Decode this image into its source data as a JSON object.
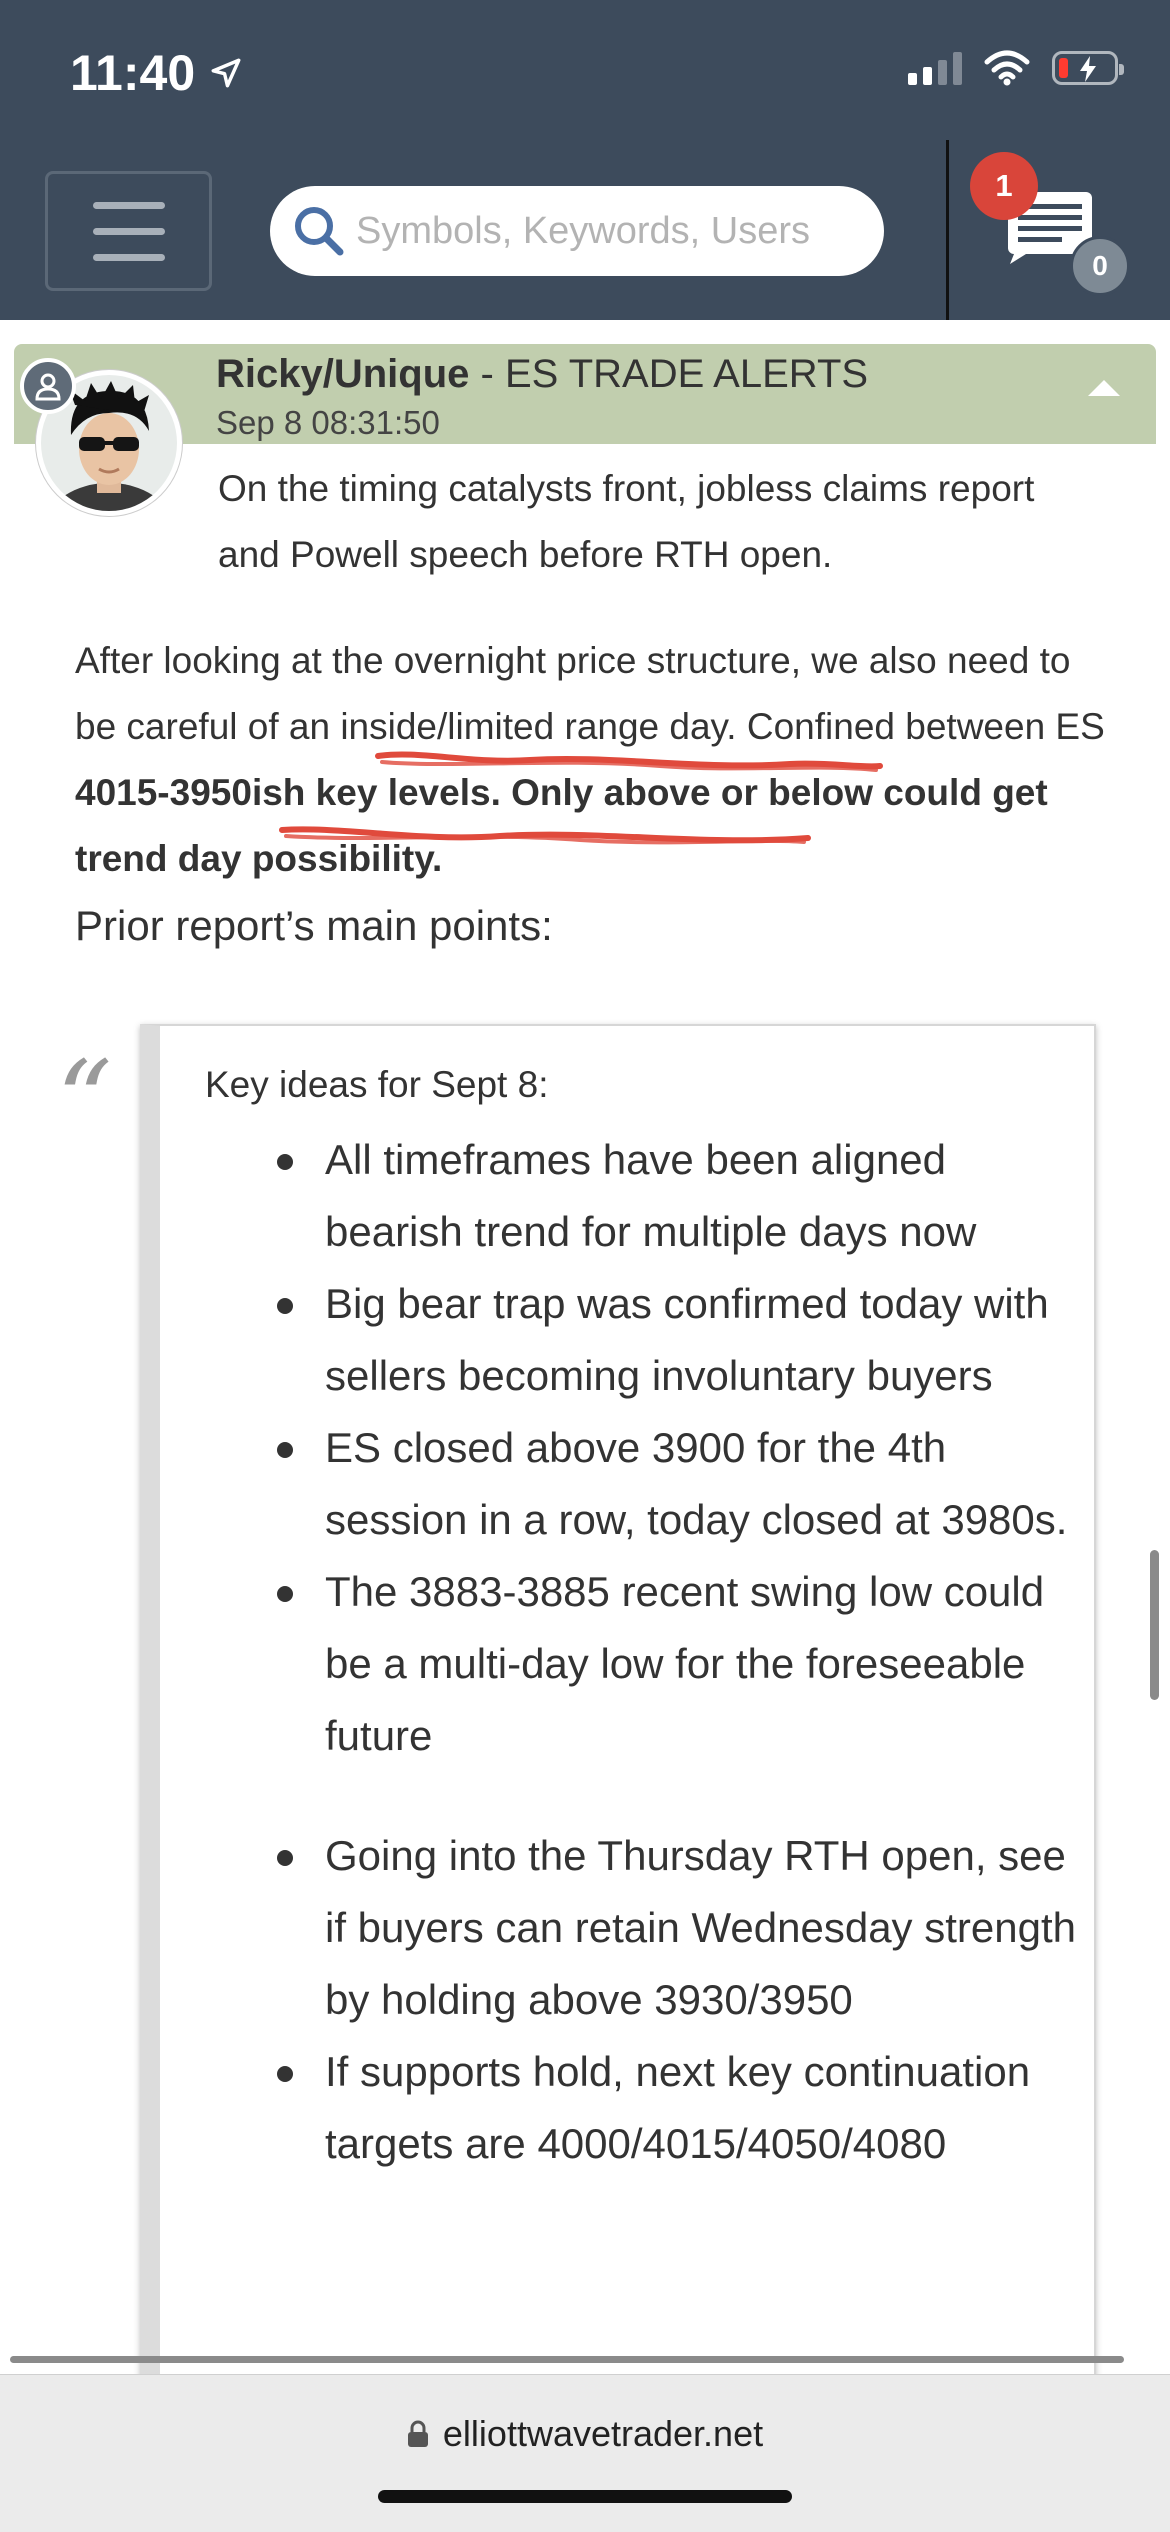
{
  "status_bar": {
    "time": "11:40"
  },
  "nav": {
    "search_placeholder": "Symbols, Keywords, Users",
    "notification_count": "1",
    "message_count": "0"
  },
  "post": {
    "author": "Ricky/Unique",
    "channel": " - ES TRADE ALERTS",
    "timestamp": "Sep 8 08:31:50",
    "paragraph1": "On the timing catalysts front, jobless claims report and Powell speech before RTH open.",
    "paragraph2_a": "After looking at the overnight price structure, we also need to be careful of an inside/limited range day. Confined between ES ",
    "paragraph2_b": "4015-3950ish key levels. Only above or below could get trend day possibility.",
    "prior_heading": "Prior report’s main points:"
  },
  "quote": {
    "title": "Key ideas for Sept 8:",
    "items": [
      "All timeframes have been aligned bearish trend for multiple days now",
      "Big bear trap was confirmed today with sellers becoming involuntary buyers",
      "ES closed above 3900 for the 4th session in a row, today closed at 3980s.",
      "The 3883-3885 recent swing low could be a multi-day low for the foreseeable future",
      "Going into the Thursday RTH open, see if buyers can retain Wednesday strength by holding above 3930/3950",
      "If supports hold, next key continuation targets are 4000/4015/4050/4080"
    ]
  },
  "browser": {
    "url": "elliottwavetrader.net"
  },
  "colors": {
    "header_bg": "#3d4b5c",
    "post_header_bg": "#c1ceae",
    "badge_red": "#d9453a",
    "annotation_red": "#e04a3c"
  },
  "icons": [
    "location-arrow-icon",
    "signal-icon",
    "wifi-icon",
    "battery-icon",
    "menu-icon",
    "search-icon",
    "messages-icon",
    "user-icon",
    "collapse-icon",
    "lock-icon"
  ]
}
